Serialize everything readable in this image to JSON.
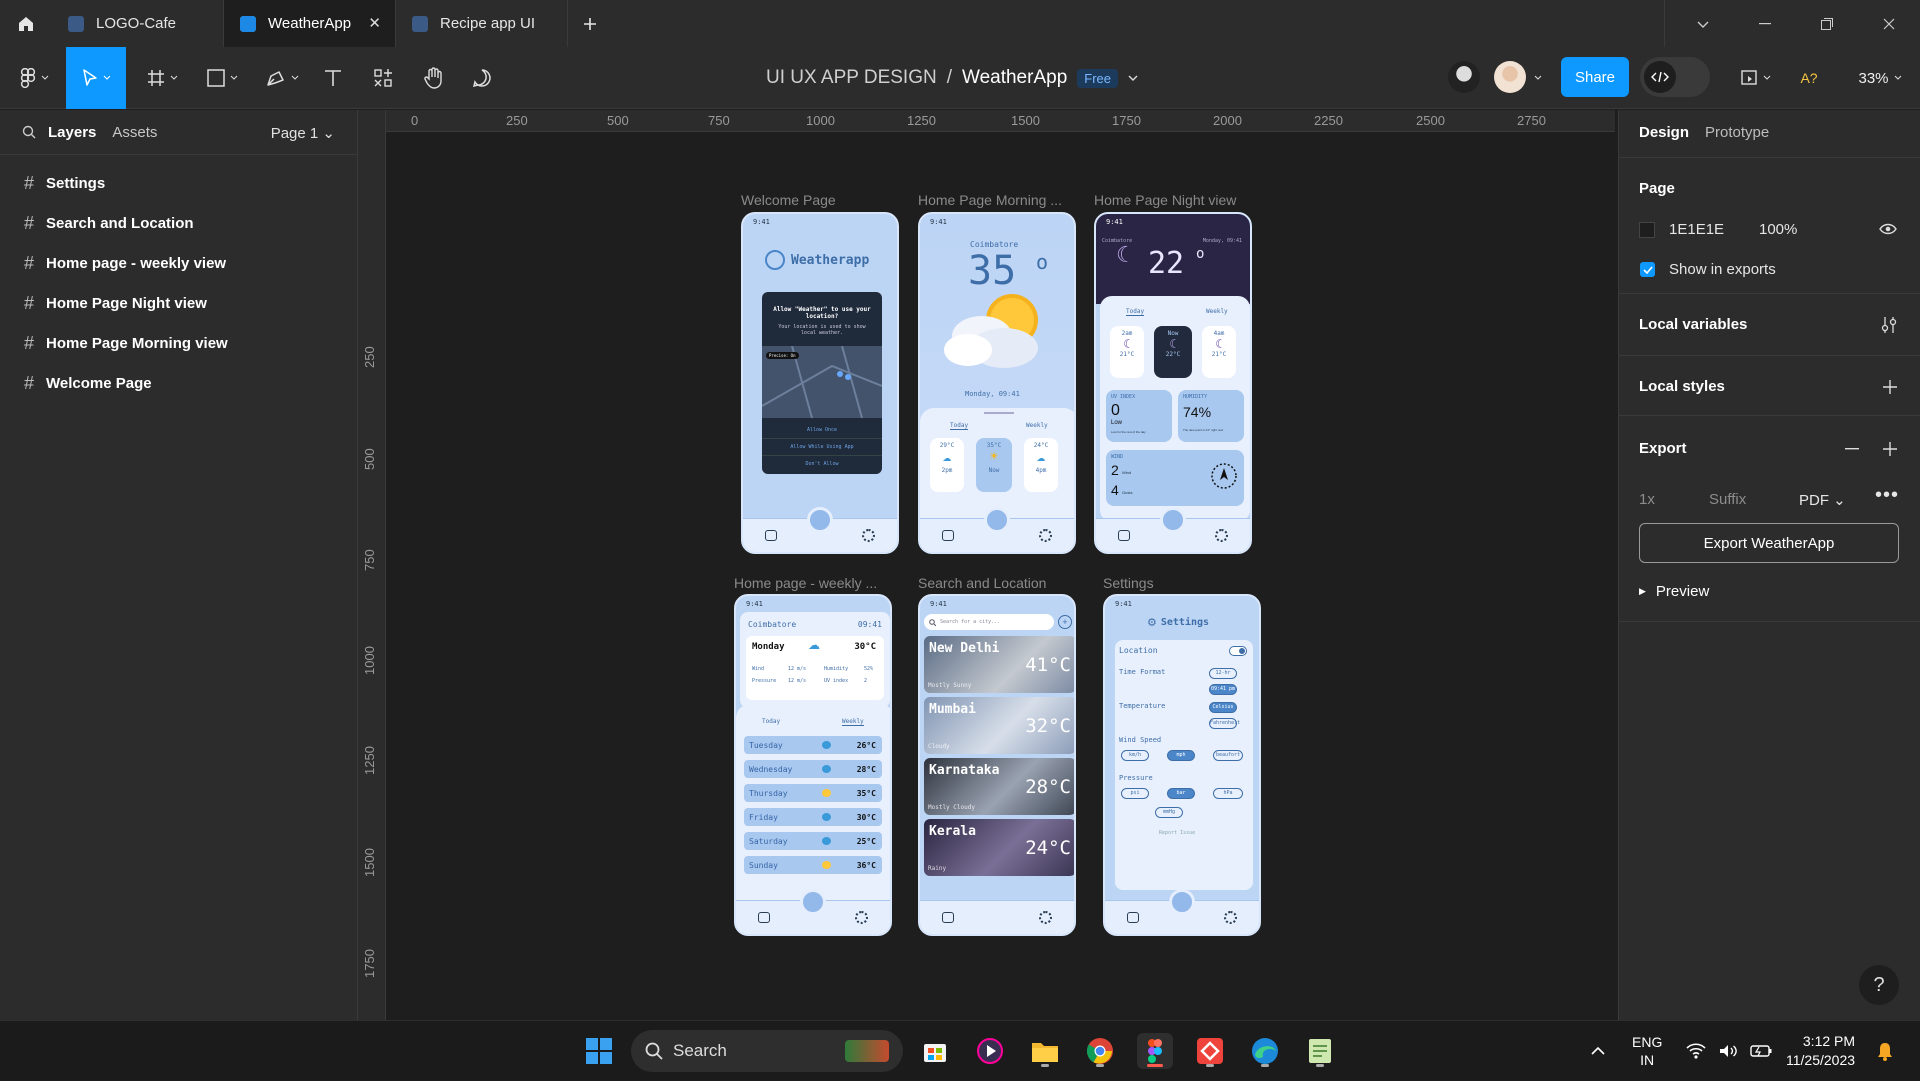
{
  "tabs": [
    {
      "label": "LOGO-Cafe",
      "active": false
    },
    {
      "label": "WeatherApp",
      "active": true
    },
    {
      "label": "Recipe app UI",
      "active": false
    }
  ],
  "breadcrumb": {
    "project": "UI UX APP DESIGN",
    "separator": "/",
    "file": "WeatherApp",
    "plan_badge": "Free"
  },
  "toolbar": {
    "share_label": "Share",
    "zoom": "33%",
    "font_hint": "A?"
  },
  "left_panel": {
    "tab_layers": "Layers",
    "tab_assets": "Assets",
    "page_selector": "Page 1",
    "layers": [
      "Settings",
      "Search and Location",
      "Home page - weekly view",
      "Home Page Night view",
      "Home Page Morning view",
      "Welcome Page"
    ]
  },
  "ruler": {
    "top": [
      "0",
      "250",
      "500",
      "750",
      "1000",
      "1250",
      "1500",
      "1750",
      "2000",
      "2250",
      "2500",
      "2750"
    ],
    "left": [
      "250",
      "500",
      "750",
      "1000",
      "1250",
      "1500",
      "1750",
      "2000"
    ]
  },
  "frames": {
    "labels": [
      "Welcome Page",
      "Home Page Morning ...",
      "Home Page Night view",
      "Home page - weekly ...",
      "Search and Location",
      "Settings"
    ],
    "status_time": "9:41",
    "welcome": {
      "app_name": "Weatherapp",
      "dialog_title": "Allow \"Weather\" to use your location?",
      "dialog_body": "Your location is used to show local weather.",
      "precise": "Precise: On",
      "allow_once": "Allow Once",
      "allow_while": "Allow While Using App",
      "dont_allow": "Don't Allow"
    },
    "morning": {
      "city": "Coimbatore",
      "temp": "35",
      "deg": "o",
      "datetime": "Monday, 09:41",
      "tab_today": "Today",
      "tab_weekly": "Weekly",
      "hours": [
        {
          "temp": "29°C",
          "time": "2pm",
          "icon": "cloud-sun-icon"
        },
        {
          "temp": "35°C",
          "time": "Now",
          "icon": "sun-icon"
        },
        {
          "temp": "24°C",
          "time": "4pm",
          "icon": "cloud-sun-icon"
        }
      ]
    },
    "night": {
      "city": "Coimbatore",
      "datetime": "Monday, 09:41",
      "temp": "22",
      "deg": "o",
      "tab_today": "Today",
      "tab_weekly": "Weekly",
      "hours": [
        {
          "time": "2am",
          "temp": "21°C"
        },
        {
          "time": "Now",
          "temp": "22°C"
        },
        {
          "time": "4am",
          "temp": "21°C"
        }
      ],
      "uv_label": "UV INDEX",
      "uv_value": "0",
      "uv_level": "Low",
      "uv_note": "Low for the rest of the day",
      "humidity_label": "HUMIDITY",
      "humidity_value": "74%",
      "humidity_note": "The dew point is 21° right now",
      "wind_label": "WIND",
      "wind_value": "2",
      "wind_unit": "Wind",
      "gust_value": "4",
      "gust_unit": "Gusts"
    },
    "weekly": {
      "city": "Coimbatore",
      "time": "09:41",
      "today_day": "Monday",
      "today_temp": "30°C",
      "stats": [
        "Wind",
        "12 m/s",
        "Humidity",
        "52%",
        "Pressure",
        "12 m/s",
        "UV index",
        "2"
      ],
      "tab_today": "Today",
      "tab_weekly": "Weekly",
      "days": [
        {
          "day": "Tuesday",
          "temp": "26°C",
          "icon": "cloud"
        },
        {
          "day": "Wednesday",
          "temp": "28°C",
          "icon": "cloud"
        },
        {
          "day": "Thursday",
          "temp": "35°C",
          "icon": "sun"
        },
        {
          "day": "Friday",
          "temp": "30°C",
          "icon": "cloud"
        },
        {
          "day": "Saturday",
          "temp": "25°C",
          "icon": "cloud"
        },
        {
          "day": "Sunday",
          "temp": "36°C",
          "icon": "sun"
        }
      ]
    },
    "search": {
      "placeholder": "Search for a city...",
      "cities": [
        {
          "name": "New Delhi",
          "temp": "41°C",
          "desc": "Mostly Sunny",
          "bg": "#6f7f96"
        },
        {
          "name": "Mumbai",
          "temp": "32°C",
          "desc": "Cloudy",
          "bg": "#9aaac2"
        },
        {
          "name": "Karnataka",
          "temp": "28°C",
          "desc": "Mostly Cloudy",
          "bg": "#3e4654"
        },
        {
          "name": "Kerala",
          "temp": "24°C",
          "desc": "Rainy",
          "bg": "#3a3553"
        }
      ]
    },
    "settings": {
      "title": "Settings",
      "location": "Location",
      "time_format": "Time Format",
      "tf_opts": [
        "12-hr",
        "09:41 pm"
      ],
      "temperature": "Temperature",
      "temp_opts": [
        "Celsius",
        "Fahrenheit"
      ],
      "wind_speed": "Wind Speed",
      "wind_opts": [
        "km/h",
        "mph",
        "beaufort"
      ],
      "pressure": "Pressure",
      "pressure_opts": [
        "psi",
        "bar",
        "hPa",
        "mmHg"
      ],
      "report": "Report Issue"
    }
  },
  "right_panel": {
    "tab_design": "Design",
    "tab_prototype": "Prototype",
    "page_title": "Page",
    "page_color": "1E1E1E",
    "page_opacity": "100%",
    "show_in_exports": "Show in exports",
    "local_variables": "Local variables",
    "local_styles": "Local styles",
    "export_title": "Export",
    "export_scale": "1x",
    "export_suffix": "Suffix",
    "export_format": "PDF",
    "export_button": "Export WeatherApp",
    "preview": "Preview",
    "help": "?"
  },
  "taskbar": {
    "search": "Search",
    "lang1": "ENG",
    "lang2": "IN",
    "time": "3:12 PM",
    "date": "11/25/2023"
  },
  "colors": {
    "accent": "#0d99ff",
    "frame_bg": "#bdd5f5",
    "panel_bg": "#2c2c2c",
    "canvas_bg": "#1e1e1e"
  }
}
